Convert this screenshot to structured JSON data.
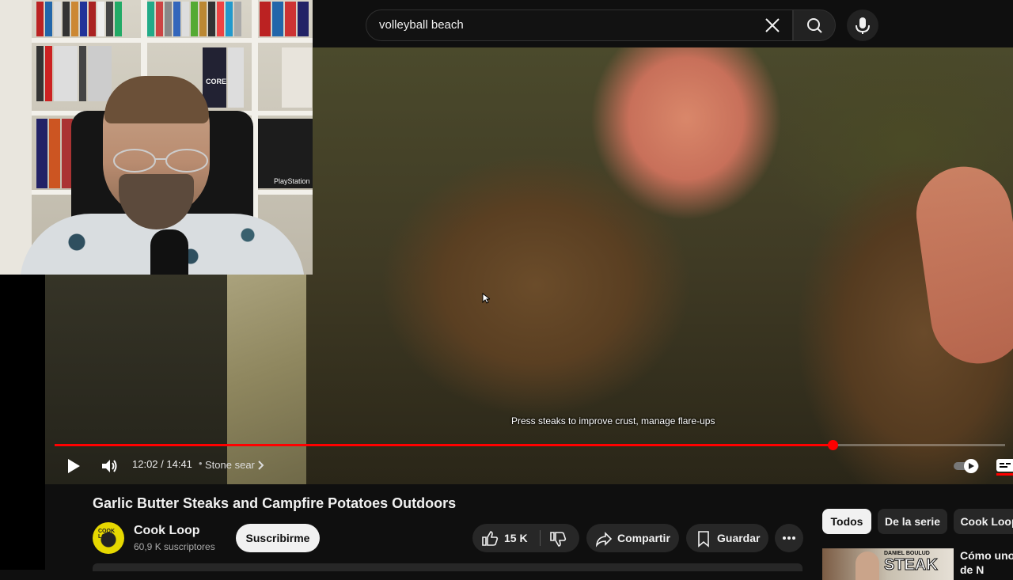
{
  "search": {
    "query": "volleyball beach"
  },
  "player": {
    "subtitle": "Press steaks to improve crust, manage flare-ups",
    "current_time": "12:02",
    "duration": "14:41",
    "time_display": "12:02 / 14:41",
    "chapter": "Stone sear",
    "progress_fraction": 0.8189,
    "accent_color": "#ff0000"
  },
  "video": {
    "title": "Garlic Butter Steaks and Campfire Potatoes Outdoors",
    "channel_name": "Cook Loop",
    "channel_avatar_text": "COOK LOOP",
    "subscribers": "60,9 K suscriptores",
    "subscribe_label": "Suscribirme",
    "likes": "15 K",
    "share_label": "Compartir",
    "save_label": "Guardar"
  },
  "related": {
    "chips": [
      "Todos",
      "De la serie",
      "Cook Loop"
    ],
    "first_thumb_small": "DANIEL BOULUD",
    "first_thumb_big": "STEAK",
    "first_title_line1": "Cómo uno",
    "first_title_line2": "de N"
  },
  "webcam": {
    "shelf_label_1": "CORE",
    "shelf_label_2": "PlayStation"
  },
  "icons": {
    "clear": "close-icon",
    "search": "search-icon",
    "mic": "microphone-icon",
    "play": "play-icon",
    "volume": "volume-icon",
    "chevron": "chevron-right-icon",
    "like": "thumbs-up-icon",
    "dislike": "thumbs-down-icon",
    "share": "share-icon",
    "save": "bookmark-icon",
    "more": "more-horizontal-icon",
    "autoplay": "autoplay-toggle-icon",
    "captions": "captions-icon"
  }
}
